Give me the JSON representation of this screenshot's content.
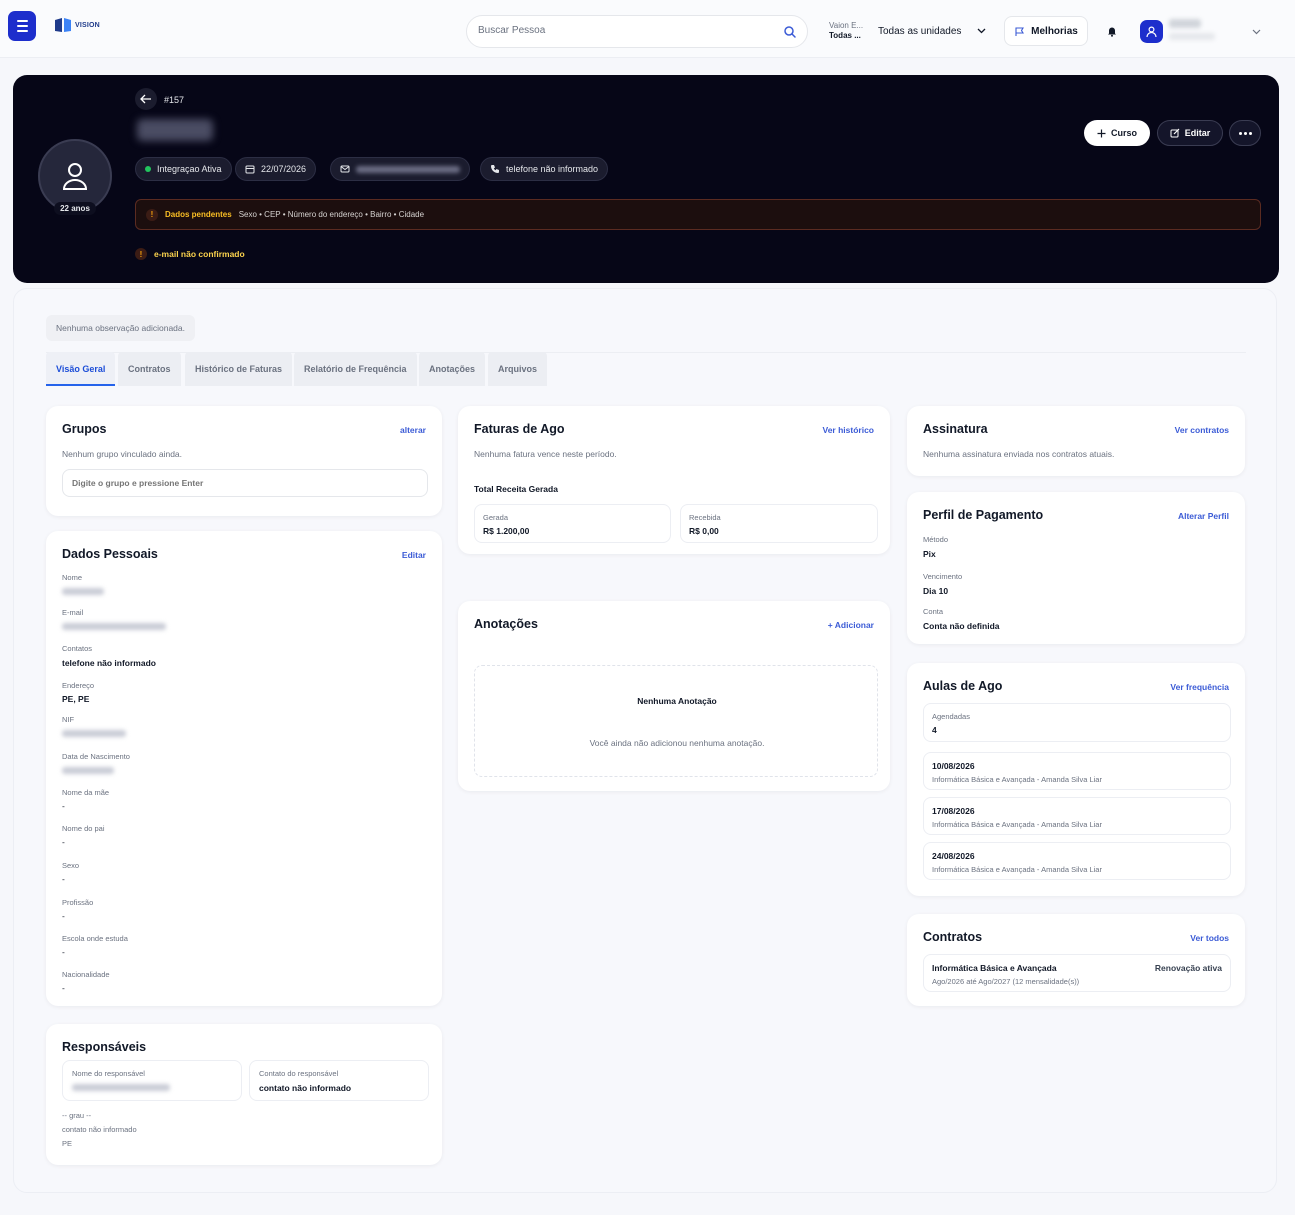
{
  "topbar": {
    "logo_text": "VISION",
    "search_placeholder": "Buscar Pessoa",
    "unit_label": "Vaion E...",
    "unit_value": "Todas ...",
    "unit_select": "Todas as unidades",
    "melhorias": "Melhorias"
  },
  "hero": {
    "id": "#157",
    "age": "22 anos",
    "status_chip": "Integraçao Ativa",
    "date_chip": "22/07/2026",
    "phone_chip": "telefone não informado",
    "btn_curso": "Curso",
    "btn_editar": "Editar",
    "pending_title": "Dados pendentes",
    "pending_fields": "Sexo • CEP • Número do endereço • Bairro • Cidade",
    "email_warning": "e-mail não confirmado"
  },
  "main": {
    "observation": "Nenhuma observação adicionada.",
    "tabs": [
      "Visão Geral",
      "Contratos",
      "Histórico de Faturas",
      "Relatório de Frequência",
      "Anotações",
      "Arquivos"
    ]
  },
  "grupos": {
    "title": "Grupos",
    "link": "alterar",
    "empty": "Nenhum grupo vinculado ainda.",
    "input_placeholder": "Digite o grupo e pressione Enter"
  },
  "dados": {
    "title": "Dados Pessoais",
    "link": "Editar",
    "nome_label": "Nome",
    "email_label": "E-mail",
    "contatos_label": "Contatos",
    "contatos_value": "telefone não informado",
    "endereco_label": "Endereço",
    "endereco_value": "PE, PE",
    "nif_label": "NIF",
    "nasc_label": "Data de Nascimento",
    "mae_label": "Nome da mãe",
    "mae_value": "-",
    "pai_label": "Nome do pai",
    "pai_value": "-",
    "sexo_label": "Sexo",
    "sexo_value": "-",
    "profissao_label": "Profissão",
    "profissao_value": "-",
    "escola_label": "Escola onde estuda",
    "escola_value": "-",
    "nacionalidade_label": "Nacionalidade",
    "nacionalidade_value": "-"
  },
  "responsaveis": {
    "title": "Responsáveis",
    "nome_label": "Nome do responsável",
    "contato_label": "Contato do responsável",
    "contato_value": "contato não informado",
    "grau": "-- grau --",
    "contato_text": "contato não informado",
    "uf": "PE"
  },
  "faturas": {
    "title": "Faturas de Ago",
    "link": "Ver histórico",
    "empty": "Nenhuma fatura vence neste período.",
    "total_label": "Total Receita Gerada",
    "gerada_label": "Gerada",
    "gerada_value": "R$ 1.200,00",
    "recebida_label": "Recebida",
    "recebida_value": "R$ 0,00"
  },
  "anotacoes": {
    "title": "Anotações",
    "link": "+ Adicionar",
    "empty_title": "Nenhuma Anotação",
    "empty_text": "Você ainda não adicionou nenhuma anotação."
  },
  "assinatura": {
    "title": "Assinatura",
    "link": "Ver contratos",
    "empty": "Nenhuma assinatura enviada nos contratos atuais."
  },
  "perfil": {
    "title": "Perfil de Pagamento",
    "link": "Alterar Perfil",
    "metodo_label": "Método",
    "metodo_value": "Pix",
    "vencimento_label": "Vencimento",
    "vencimento_value": "Dia 10",
    "conta_label": "Conta",
    "conta_value": "Conta não definida"
  },
  "aulas": {
    "title": "Aulas de Ago",
    "link": "Ver frequência",
    "agendadas_label": "Agendadas",
    "agendadas_value": "4",
    "items": [
      {
        "date": "10/08/2026",
        "desc": "Informática Básica e Avançada - Amanda Silva Liar"
      },
      {
        "date": "17/08/2026",
        "desc": "Informática Básica e Avançada - Amanda Silva Liar"
      },
      {
        "date": "24/08/2026",
        "desc": "Informática Básica e Avançada - Amanda Silva Liar"
      }
    ]
  },
  "contratos": {
    "title": "Contratos",
    "link": "Ver todos",
    "item_title": "Informática Básica e Avançada",
    "item_status": "Renovação ativa",
    "item_period": "Ago/2026 até Ago/2027 (12 mensalidade(s))"
  },
  "colors": {
    "accent": "#1d2ecc",
    "link": "#3b5bd6",
    "hero_bg": "#060617",
    "warning": "#fbbf24",
    "success": "#22c55e"
  }
}
